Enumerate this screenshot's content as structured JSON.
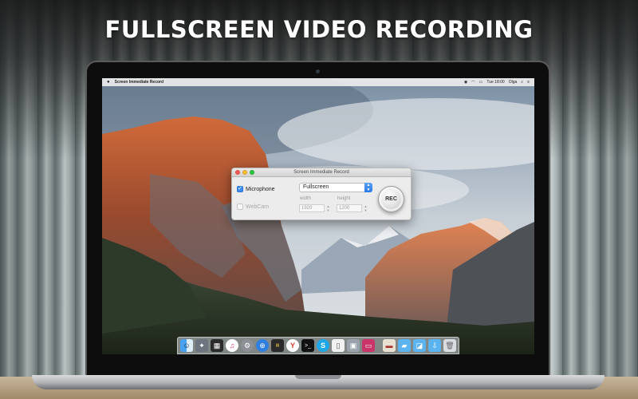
{
  "headline": "FULLSCREEN VIDEO RECORDING",
  "menubar": {
    "app_name": "Screen Immediate Record",
    "time": "Tue 18:00",
    "user": "Olga"
  },
  "window": {
    "title": "Screen Immediate Record",
    "microphone_label": "Microphone",
    "microphone_checked": true,
    "webcam_label": "WebCam",
    "webcam_checked": false,
    "mode_value": "Fullscreen",
    "width_label": "width",
    "height_label": "height",
    "width_value": "1920",
    "height_value": "1200",
    "rec_label": "REC"
  },
  "dock": {
    "icons": [
      "finder-icon",
      "launchpad-icon",
      "mission-control-icon",
      "itunes-icon",
      "system-preferences-icon",
      "safari-icon",
      "terminal-logger-icon",
      "yandex-browser-icon",
      "terminal-icon",
      "skype-icon",
      "preview-icon",
      "screen-record-icon",
      "photo-booth-icon",
      "folder-icon",
      "folder-icon",
      "downloads-icon",
      "trash-icon"
    ]
  },
  "colors": {
    "accent": "#3d8df5",
    "close": "#fc5f57",
    "minimize": "#fdbc2e",
    "maximize": "#28c840"
  }
}
